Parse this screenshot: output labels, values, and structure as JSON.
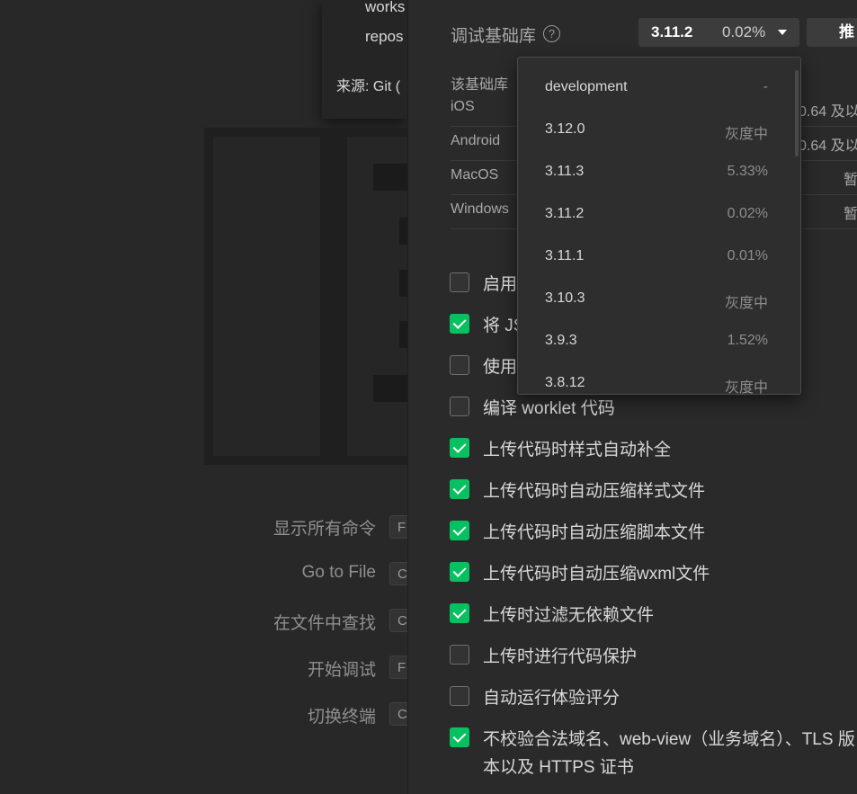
{
  "background": {
    "popup_lines": [
      "works",
      "repos"
    ],
    "popup_source": "来源: Git (",
    "commands": [
      {
        "label": "显示所有命令",
        "key": "F"
      },
      {
        "label": "Go to File",
        "key": "C"
      },
      {
        "label": "在文件中查找",
        "key": "C"
      },
      {
        "label": "开始调试",
        "key": "F"
      },
      {
        "label": "切换终端",
        "key": "C"
      }
    ]
  },
  "settings": {
    "lib_label": "调试基础库",
    "help_icon": "?",
    "selected_version": "3.11.2",
    "selected_pct": "0.02%",
    "recommend_label": "推",
    "support_title": "该基础库",
    "platforms": [
      {
        "name": "iOS",
        "value": "0.64 及以"
      },
      {
        "name": "Android",
        "value": "0.64 及以"
      },
      {
        "name": "MacOS",
        "value": "暂"
      },
      {
        "name": "Windows",
        "value": "暂"
      }
    ],
    "options": [
      {
        "label": "启用",
        "checked": false
      },
      {
        "label": "将 JS",
        "checked": true
      },
      {
        "label": "使用",
        "checked": false
      },
      {
        "label": "编译 worklet 代码",
        "checked": false
      },
      {
        "label": "上传代码时样式自动补全",
        "checked": true
      },
      {
        "label": "上传代码时自动压缩样式文件",
        "checked": true
      },
      {
        "label": "上传代码时自动压缩脚本文件",
        "checked": true
      },
      {
        "label": "上传代码时自动压缩wxml文件",
        "checked": true
      },
      {
        "label": "上传时过滤无依赖文件",
        "checked": true
      },
      {
        "label": "上传时进行代码保护",
        "checked": false
      },
      {
        "label": "自动运行体验评分",
        "checked": false
      },
      {
        "label": "不校验合法域名、web-view（业务域名）、TLS 版",
        "label2": "本以及 HTTPS 证书",
        "checked": true
      }
    ]
  },
  "dropdown": {
    "items": [
      {
        "version": "development",
        "pct": "-"
      },
      {
        "version": "3.12.0",
        "pct": "灰度中"
      },
      {
        "version": "3.11.3",
        "pct": "5.33%"
      },
      {
        "version": "3.11.2",
        "pct": "0.02%"
      },
      {
        "version": "3.11.1",
        "pct": "0.01%"
      },
      {
        "version": "3.10.3",
        "pct": "灰度中"
      },
      {
        "version": "3.9.3",
        "pct": "1.52%"
      },
      {
        "version": "3.8.12",
        "pct": "灰度中"
      }
    ]
  },
  "colors": {
    "checkbox_on": "#07c160",
    "panel_bg": "#2a2a2a",
    "dropdown_bg": "#2e2e2e"
  }
}
